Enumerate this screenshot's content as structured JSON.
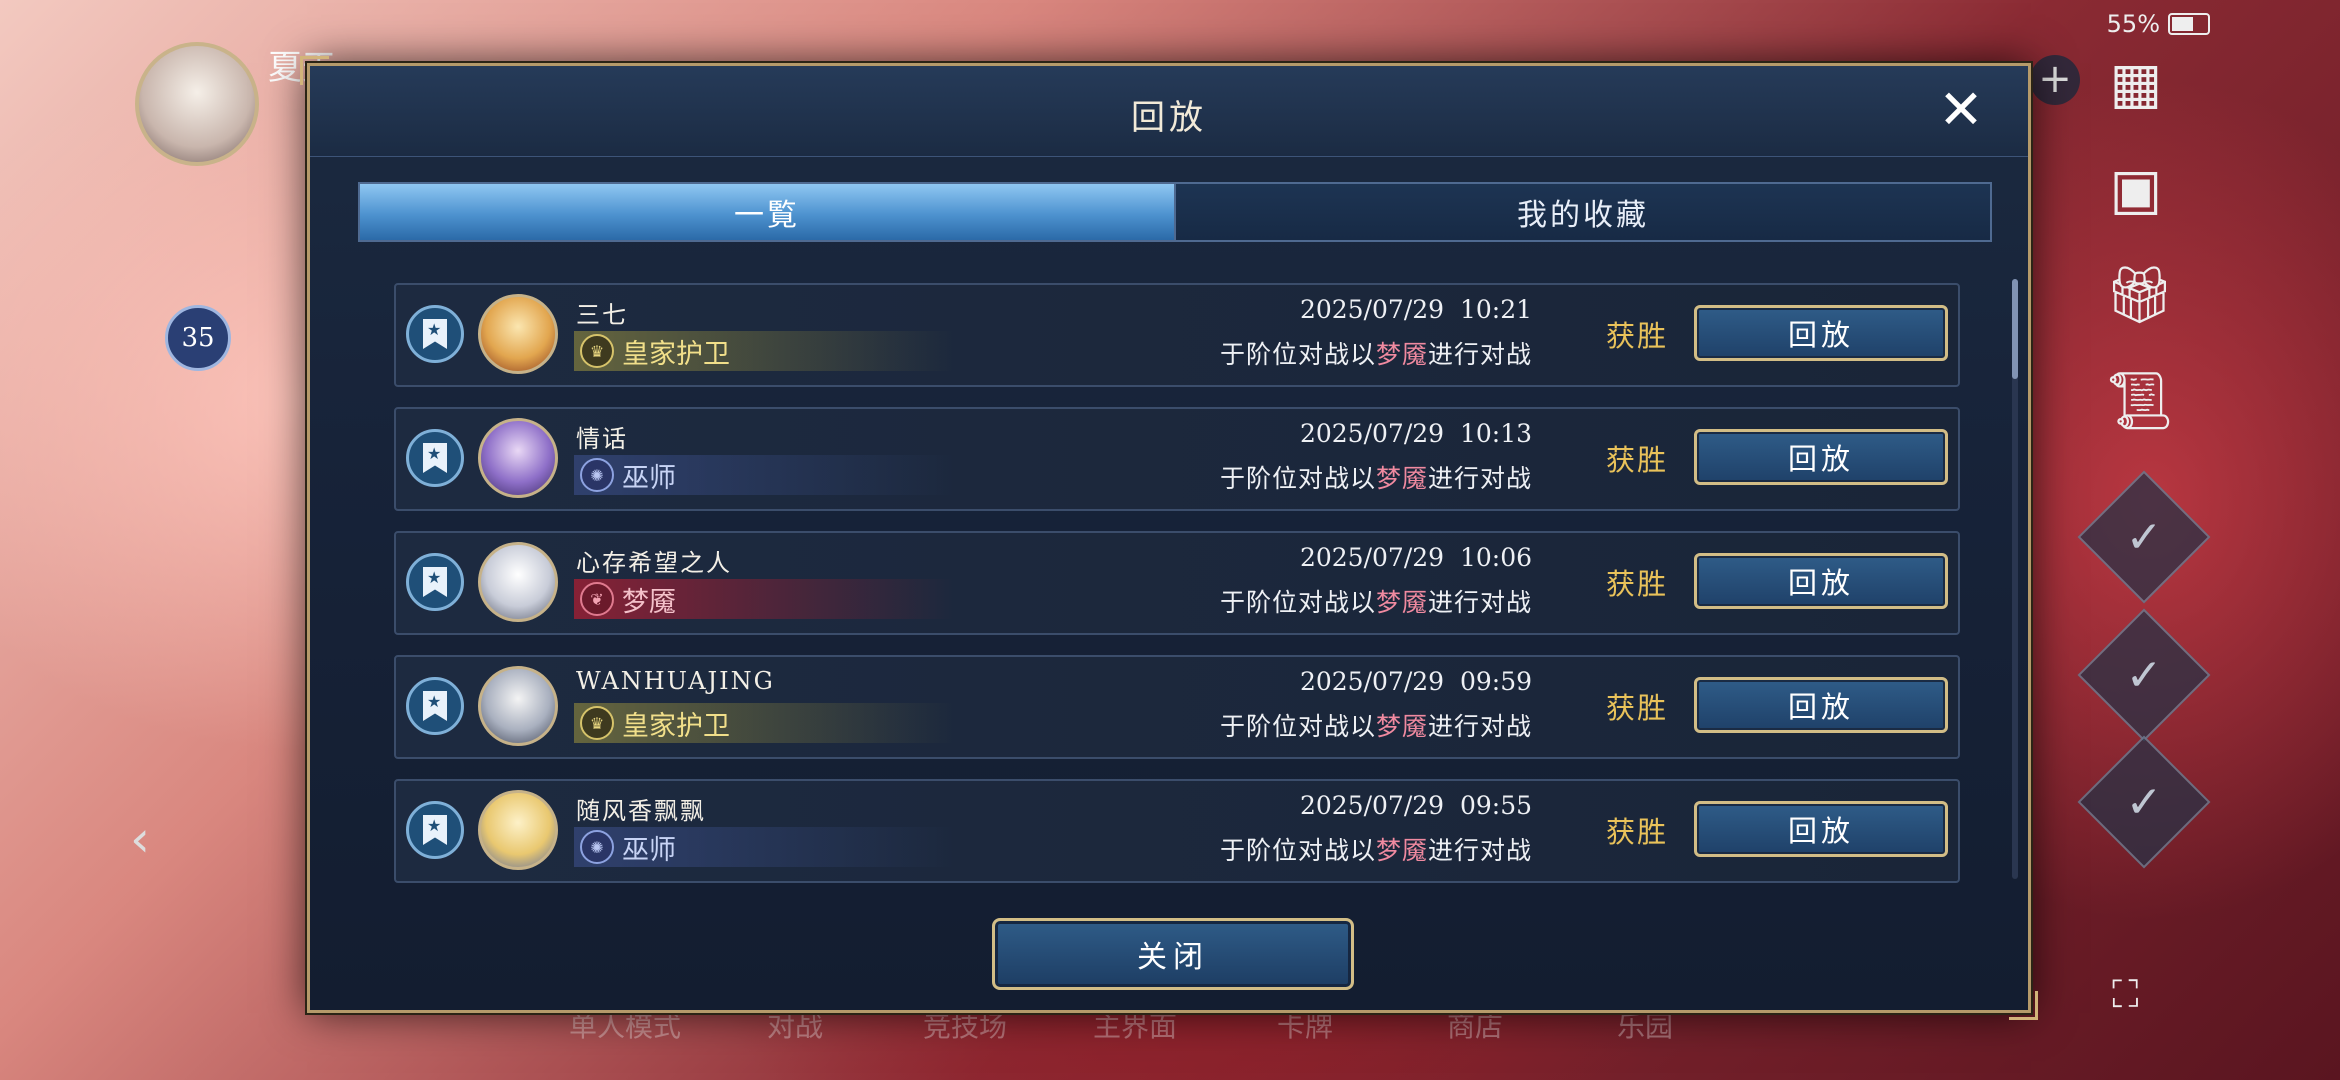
{
  "status": {
    "battery": "55%"
  },
  "background": {
    "player_name": "夏天",
    "level": "35",
    "bottom_nav": [
      "单人模式",
      "对战",
      "竞技场",
      "主界面",
      "卡牌",
      "商店",
      "乐园"
    ]
  },
  "modal": {
    "title": "回放",
    "tabs": [
      {
        "label": "一覧",
        "active": true
      },
      {
        "label": "我的收藏",
        "active": false
      }
    ],
    "close_label": "关闭",
    "rows": [
      {
        "player": "三七",
        "class": "皇家护卫",
        "class_style": "gold",
        "datetime": "2025/07/29  10:21",
        "desc_prefix": "于阶位对战以",
        "desc_class": "梦魇",
        "desc_suffix": "进行对战",
        "result": "获胜",
        "replay": "回放"
      },
      {
        "player": "情话",
        "class": "巫师",
        "class_style": "blue",
        "datetime": "2025/07/29  10:13",
        "desc_prefix": "于阶位对战以",
        "desc_class": "梦魇",
        "desc_suffix": "进行对战",
        "result": "获胜",
        "replay": "回放"
      },
      {
        "player": "心存希望之人",
        "class": "梦魇",
        "class_style": "red",
        "datetime": "2025/07/29  10:06",
        "desc_prefix": "于阶位对战以",
        "desc_class": "梦魇",
        "desc_suffix": "进行对战",
        "result": "获胜",
        "replay": "回放"
      },
      {
        "player": "WANHUAJING",
        "class": "皇家护卫",
        "class_style": "gold",
        "datetime": "2025/07/29  09:59",
        "desc_prefix": "于阶位对战以",
        "desc_class": "梦魇",
        "desc_suffix": "进行对战",
        "result": "获胜",
        "replay": "回放"
      },
      {
        "player": "随风香飘飘",
        "class": "巫师",
        "class_style": "blue",
        "datetime": "2025/07/29  09:55",
        "desc_prefix": "于阶位对战以",
        "desc_class": "梦魇",
        "desc_suffix": "进行对战",
        "result": "获胜",
        "replay": "回放"
      }
    ]
  }
}
